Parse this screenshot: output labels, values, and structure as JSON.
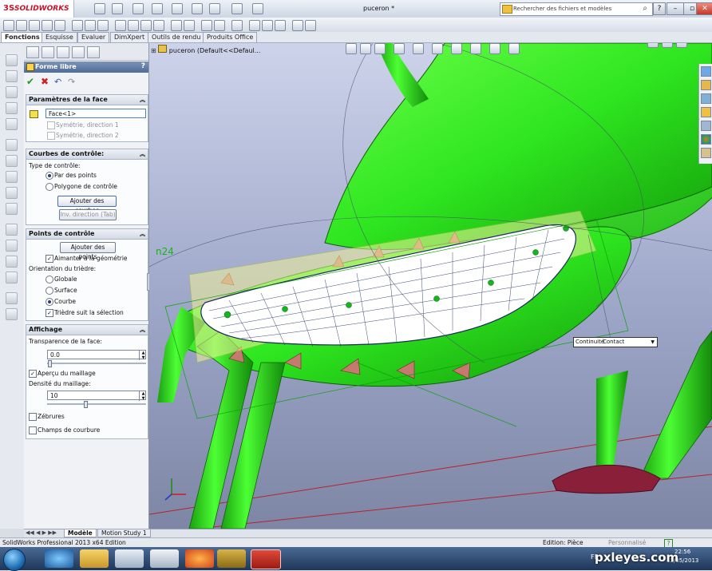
{
  "app": {
    "brand": "SOLIDWORKS",
    "brand_mark": "3S",
    "document_title": "puceron *"
  },
  "search": {
    "placeholder": "Rechercher des fichiers et modèles"
  },
  "window_controls": {
    "help": "?",
    "minimize": "–",
    "restore": "▫",
    "close": "✕"
  },
  "tabs": [
    {
      "label": "Fonctions",
      "active": true
    },
    {
      "label": "Esquisse"
    },
    {
      "label": "Evaluer"
    },
    {
      "label": "DimXpert"
    },
    {
      "label": "Outils de rendu"
    },
    {
      "label": "Produits Office"
    }
  ],
  "property_manager": {
    "title": "Forme libre",
    "help": "?",
    "sections": {
      "face": {
        "title": "Paramètres de la face",
        "face_value": "Face<1>",
        "sym1": "Symétrie, direction 1",
        "sym2": "Symétrie, direction 2"
      },
      "curves": {
        "title": "Courbes de contrôle:",
        "type_label": "Type de contrôle:",
        "opt_points": "Par des points",
        "opt_polygon": "Polygone de contrôle",
        "add_curves": "Ajouter des courbes",
        "inv_direction": "Inv. direction (Tab)"
      },
      "points": {
        "title": "Points de contrôle",
        "add_points": "Ajouter des points",
        "snap": "Aimanter à la géométrie",
        "orientation_label": "Orientation du trièdre:",
        "opt_global": "Globale",
        "opt_surface": "Surface",
        "opt_curve": "Courbe",
        "follow_selection": "Trièdre suit la sélection"
      },
      "display": {
        "title": "Affichage",
        "transparency_label": "Transparence de la face:",
        "transparency_value": "0.0",
        "mesh_preview": "Aperçu du maillage",
        "mesh_density_label": "Densité du maillage:",
        "mesh_density_value": "10",
        "zebra": "Zébrures",
        "curvature": "Champs de courbure"
      }
    }
  },
  "viewport": {
    "tree_path": "puceron  (Default<<Defaul...",
    "sketch_label": "n24",
    "tooltip_label": "Continuité",
    "tooltip_value": "Contact"
  },
  "bottom_tabs": [
    "Modèle",
    "Motion Study 1"
  ],
  "status": {
    "left": "SolidWorks Professional 2013 x64 Edition",
    "mode": "Edition: Pièce",
    "custom": "Personnalisé",
    "help": "?"
  },
  "taskbar": {
    "language": "FR",
    "time": "22:56",
    "date": "13/05/2013",
    "watermark": "pxleyes.com"
  },
  "colors": {
    "model_green": "#2ee61f",
    "dark_green": "#138a0b",
    "pm_header": "#4f6c98"
  }
}
